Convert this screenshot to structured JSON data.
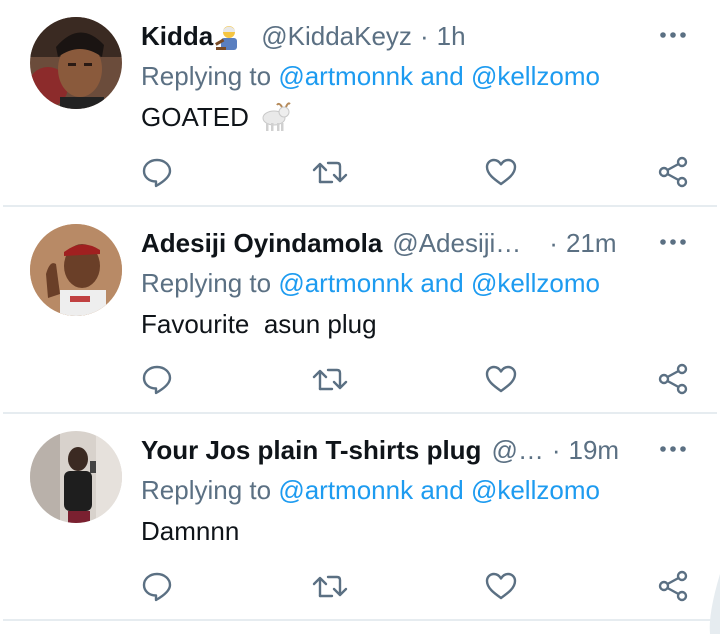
{
  "colors": {
    "text": "#0f1419",
    "secondary": "#5b7083",
    "mention": "#1d9bf0",
    "divider": "#e6ecf0",
    "icon": "#5b7083"
  },
  "replying_prefix": "Replying to",
  "tweets": [
    {
      "name": "Kidda",
      "name_emoji": "judge-emoji",
      "handle": "@KiddaKeyz",
      "separator": "·",
      "time": "1h",
      "mention1": "@artmonnk",
      "conj": "and",
      "mention2": "@kellzomo",
      "text": "GOATED",
      "text_emoji": "goat-emoji"
    },
    {
      "name": "Adesiji Oyindamola",
      "handle": "@Adesiji…",
      "separator": "·",
      "time": "21m",
      "mention1": "@artmonnk",
      "conj": "and",
      "mention2": "@kellzomo",
      "text": "Favourite  asun plug"
    },
    {
      "name": "Your Jos plain T-shirts plug",
      "handle": "@…",
      "separator": "·",
      "time": "19m",
      "mention1": "@artmonnk",
      "conj": "and",
      "mention2": "@kellzomo",
      "text": "Damnnn"
    }
  ],
  "icons": {
    "reply": "reply-icon",
    "retweet": "retweet-icon",
    "like": "heart-icon",
    "share": "share-icon",
    "more": "more-dots-icon"
  }
}
